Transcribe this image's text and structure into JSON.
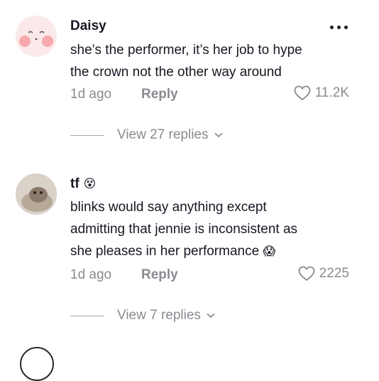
{
  "comments": [
    {
      "username": "Daisy",
      "lines": [
        "she’s the performer, it’s her job to hype",
        "the crown not the other way around"
      ],
      "time": "1d ago",
      "reply_label": "Reply",
      "likes": "11.2K",
      "view_replies": "View 27 replies",
      "has_more_menu": true
    },
    {
      "username": "tf",
      "username_emoji": "😵",
      "lines": [
        "blinks would say anything except",
        "admitting that jennie is inconsistent as",
        "she pleases in her performance"
      ],
      "line_end_emoji": "😱",
      "time": "1d ago",
      "reply_label": "Reply",
      "likes": "2225",
      "view_replies": "View 7 replies"
    }
  ],
  "icons": {
    "like": "heart-outline-icon",
    "more": "more-dots-icon",
    "expand": "chevron-down-icon"
  },
  "colors": {
    "text": "#161823",
    "muted": "#8a8b91"
  }
}
